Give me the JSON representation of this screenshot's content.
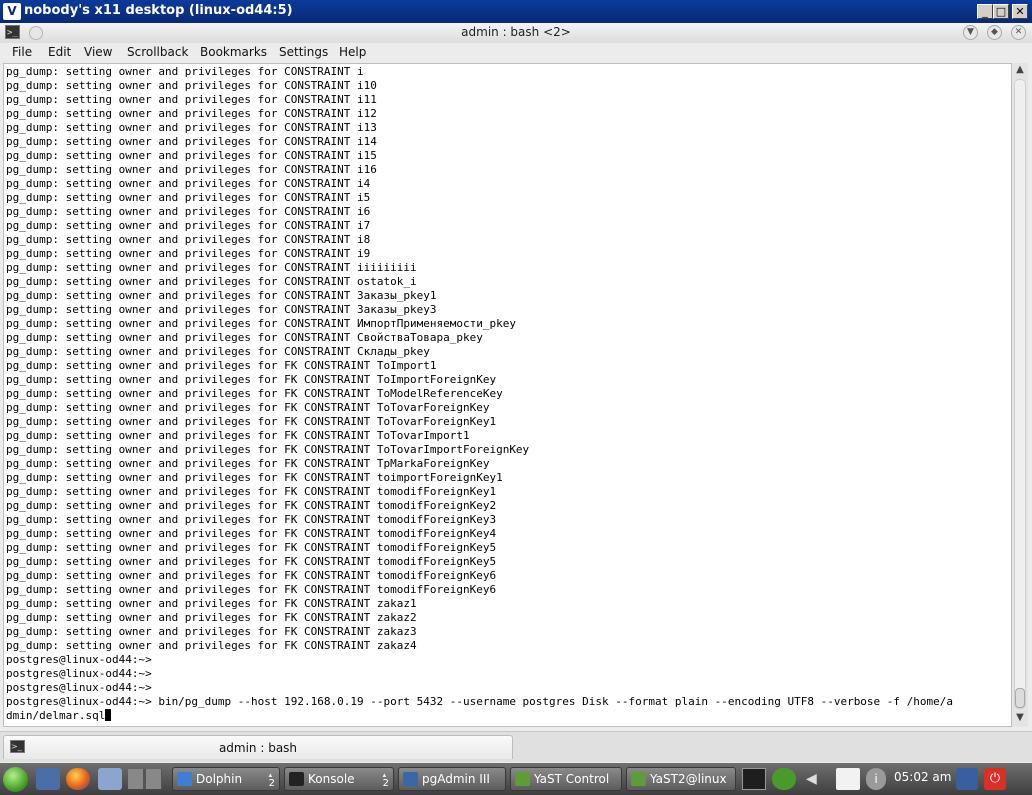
{
  "vnc": {
    "icon": "V",
    "title": "nobody's x11 desktop (linux-od44:5)",
    "buttons": [
      "_",
      "□",
      "✕"
    ]
  },
  "konsole": {
    "title": "admin : bash <2>",
    "menu": [
      "File",
      "Edit",
      "View",
      "Scrollback",
      "Bookmarks",
      "Settings",
      "Help"
    ],
    "tab_label": "admin : bash"
  },
  "terminal": {
    "lines": [
      "pg_dump: setting owner and privileges for CONSTRAINT i",
      "pg_dump: setting owner and privileges for CONSTRAINT i10",
      "pg_dump: setting owner and privileges for CONSTRAINT i11",
      "pg_dump: setting owner and privileges for CONSTRAINT i12",
      "pg_dump: setting owner and privileges for CONSTRAINT i13",
      "pg_dump: setting owner and privileges for CONSTRAINT i14",
      "pg_dump: setting owner and privileges for CONSTRAINT i15",
      "pg_dump: setting owner and privileges for CONSTRAINT i16",
      "pg_dump: setting owner and privileges for CONSTRAINT i4",
      "pg_dump: setting owner and privileges for CONSTRAINT i5",
      "pg_dump: setting owner and privileges for CONSTRAINT i6",
      "pg_dump: setting owner and privileges for CONSTRAINT i7",
      "pg_dump: setting owner and privileges for CONSTRAINT i8",
      "pg_dump: setting owner and privileges for CONSTRAINT i9",
      "pg_dump: setting owner and privileges for CONSTRAINT iiiiiiiii",
      "pg_dump: setting owner and privileges for CONSTRAINT ostatok_i",
      "pg_dump: setting owner and privileges for CONSTRAINT Заказы_pkey1",
      "pg_dump: setting owner and privileges for CONSTRAINT Заказы_pkey3",
      "pg_dump: setting owner and privileges for CONSTRAINT ИмпортПрименяемости_pkey",
      "pg_dump: setting owner and privileges for CONSTRAINT СвойстваТовара_pkey",
      "pg_dump: setting owner and privileges for CONSTRAINT Склады_pkey",
      "pg_dump: setting owner and privileges for FK CONSTRAINT ToImport1",
      "pg_dump: setting owner and privileges for FK CONSTRAINT ToImportForeignKey",
      "pg_dump: setting owner and privileges for FK CONSTRAINT ToModelReferenceKey",
      "pg_dump: setting owner and privileges for FK CONSTRAINT ToTovarForeignKey",
      "pg_dump: setting owner and privileges for FK CONSTRAINT ToTovarForeignKey1",
      "pg_dump: setting owner and privileges for FK CONSTRAINT ToTovarImport1",
      "pg_dump: setting owner and privileges for FK CONSTRAINT ToTovarImportForeignKey",
      "pg_dump: setting owner and privileges for FK CONSTRAINT TpMarkaForeignKey",
      "pg_dump: setting owner and privileges for FK CONSTRAINT toimportForeignKey1",
      "pg_dump: setting owner and privileges for FK CONSTRAINT tomodifForeignKey1",
      "pg_dump: setting owner and privileges for FK CONSTRAINT tomodifForeignKey2",
      "pg_dump: setting owner and privileges for FK CONSTRAINT tomodifForeignKey3",
      "pg_dump: setting owner and privileges for FK CONSTRAINT tomodifForeignKey4",
      "pg_dump: setting owner and privileges for FK CONSTRAINT tomodifForeignKey5",
      "pg_dump: setting owner and privileges for FK CONSTRAINT tomodifForeignKey5",
      "pg_dump: setting owner and privileges for FK CONSTRAINT tomodifForeignKey6",
      "pg_dump: setting owner and privileges for FK CONSTRAINT tomodifForeignKey6",
      "pg_dump: setting owner and privileges for FK CONSTRAINT zakaz1",
      "pg_dump: setting owner and privileges for FK CONSTRAINT zakaz2",
      "pg_dump: setting owner and privileges for FK CONSTRAINT zakaz3",
      "pg_dump: setting owner and privileges for FK CONSTRAINT zakaz4",
      "postgres@linux-od44:~>",
      "postgres@linux-od44:~>",
      "postgres@linux-od44:~>",
      "postgres@linux-od44:~> bin/pg_dump --host 192.168.0.19 --port 5432 --username postgres Disk --format plain --encoding UTF8 --verbose -f /home/a",
      "dmin/delmar.sql"
    ]
  },
  "taskbar": {
    "tasks": [
      {
        "label": "Dolphin",
        "count": "2",
        "icon_color": "#3d7fd6",
        "icon": "folder-icon"
      },
      {
        "label": "Konsole",
        "count": "2",
        "icon_color": "#222222",
        "icon": "terminal-icon"
      },
      {
        "label": "pgAdmin III",
        "count": "",
        "icon_color": "#3569a8",
        "icon": "elephant-icon"
      },
      {
        "label": "YaST Control",
        "count": "",
        "icon_color": "#5e9c35",
        "icon": "yast-icon"
      },
      {
        "label": "YaST2@linux",
        "count": "",
        "icon_color": "#5e9c35",
        "icon": "yast-icon"
      }
    ],
    "clock": "05:02 am"
  }
}
